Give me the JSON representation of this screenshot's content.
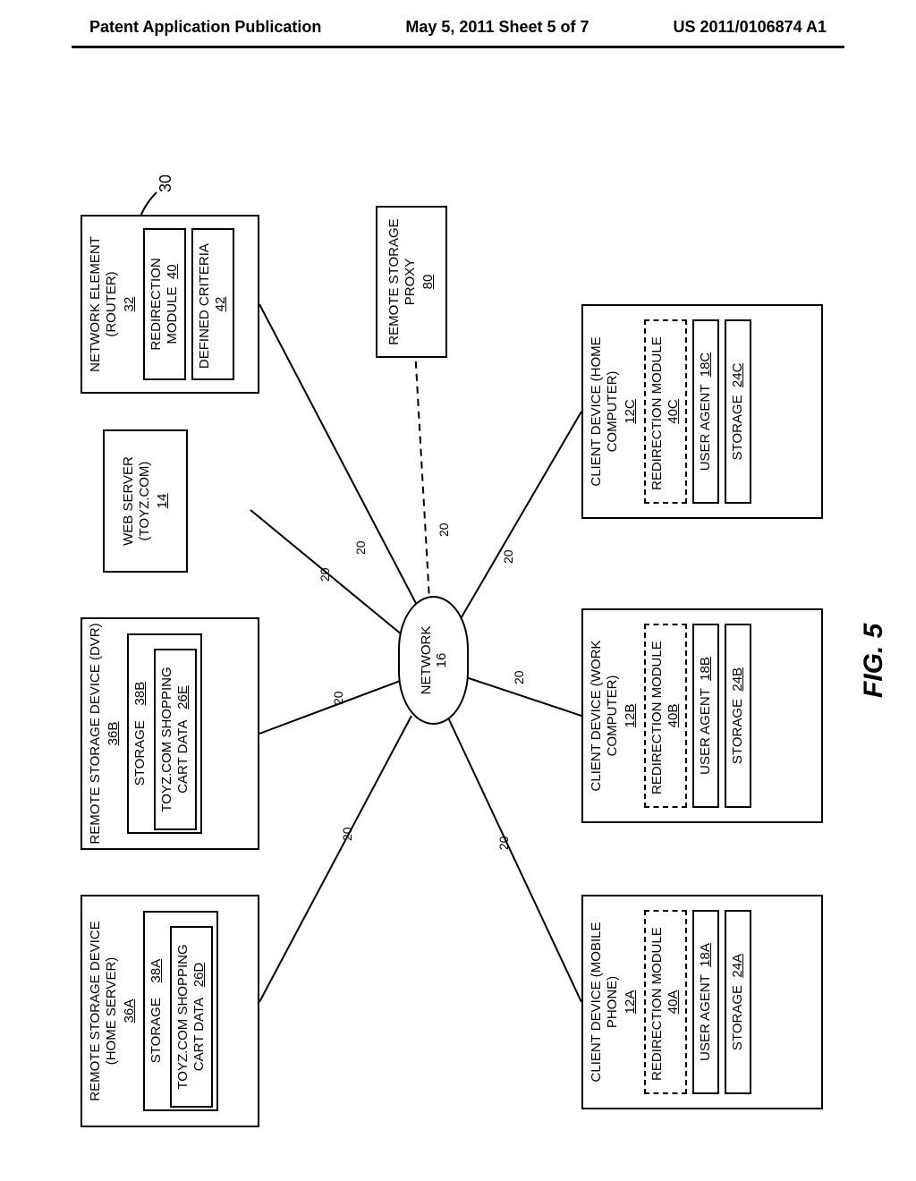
{
  "header": {
    "left": "Patent Application Publication",
    "center": "May 5, 2011   Sheet 5 of 7",
    "right": "US 2011/0106874 A1"
  },
  "fig": {
    "caption": "FIG. 5",
    "system_ref": "30"
  },
  "cloud": {
    "label": "NETWORK",
    "ref": "16"
  },
  "conn_label": "20",
  "rsd_a": {
    "title": "REMOTE STORAGE DEVICE (HOME SERVER)",
    "ref": "36A",
    "storage_label": "STORAGE",
    "storage_ref": "38A",
    "data_label": "TOYZ.COM SHOPPING CART DATA",
    "data_ref": "26D"
  },
  "rsd_b": {
    "title": "REMOTE STORAGE DEVICE (DVR)",
    "ref": "36B",
    "storage_label": "STORAGE",
    "storage_ref": "38B",
    "data_label": "TOYZ.COM SHOPPING CART DATA",
    "data_ref": "26E"
  },
  "webserver": {
    "title": "WEB SERVER (TOYZ.COM)",
    "ref": "14"
  },
  "netelem": {
    "title": "NETWORK ELEMENT (ROUTER)",
    "ref": "32",
    "redir_label": "REDIRECTION MODULE",
    "redir_ref": "40",
    "criteria_label": "DEFINED CRITERIA",
    "criteria_ref": "42"
  },
  "proxy": {
    "title": "REMOTE STORAGE PROXY",
    "ref": "80"
  },
  "client_a": {
    "title": "CLIENT DEVICE (MOBILE PHONE)",
    "ref": "12A",
    "redir_label": "REDIRECTION MODULE",
    "redir_ref": "40A",
    "ua_label": "USER AGENT",
    "ua_ref": "18A",
    "st_label": "STORAGE",
    "st_ref": "24A"
  },
  "client_b": {
    "title": "CLIENT DEVICE (WORK COMPUTER)",
    "ref": "12B",
    "redir_label": "REDIRECTION MODULE",
    "redir_ref": "40B",
    "ua_label": "USER AGENT",
    "ua_ref": "18B",
    "st_label": "STORAGE",
    "st_ref": "24B"
  },
  "client_c": {
    "title": "CLIENT DEVICE (HOME COMPUTER)",
    "ref": "12C",
    "redir_label": "REDIRECTION MODULE",
    "redir_ref": "40C",
    "ua_label": "USER AGENT",
    "ua_ref": "18C",
    "st_label": "STORAGE",
    "st_ref": "24C"
  }
}
